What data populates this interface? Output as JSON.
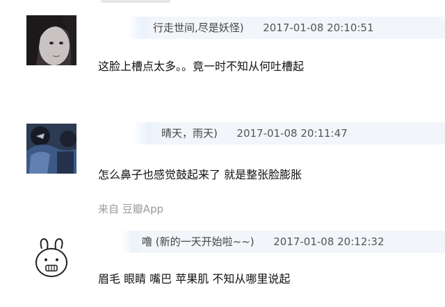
{
  "comments": [
    {
      "author": "行走世间,尽是妖怪)",
      "time": "2017-01-08 20:10:51",
      "text": "这脸上槽点太多。。竟一时不知从何吐槽起"
    },
    {
      "author": "晴天，雨天)",
      "time": "2017-01-08 20:11:47",
      "text": "怎么鼻子也感觉鼓起来了 就是整张脸膨胀",
      "source": "来自 豆瓣App"
    },
    {
      "author": "噜 (新的一天开始啦~~)",
      "time": "2017-01-08 20:12:32",
      "text": "眉毛 眼睛 嘴巴 苹果肌 不知从哪里说起"
    }
  ]
}
